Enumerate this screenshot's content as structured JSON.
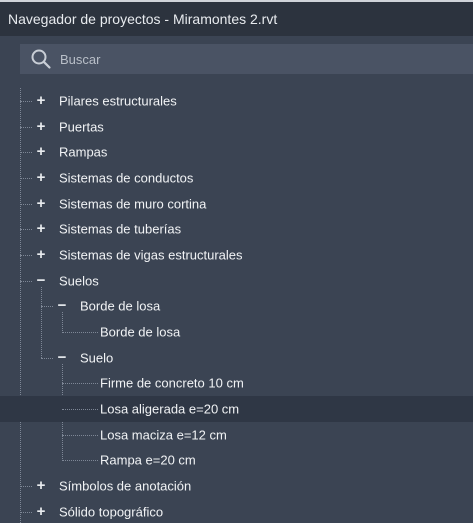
{
  "window": {
    "title": "Navegador de proyectos - Miramontes 2.rvt"
  },
  "search": {
    "placeholder": "Buscar",
    "value": ""
  },
  "tree": [
    {
      "label": "Pilares estructurales",
      "level": 0,
      "state": "collapsed"
    },
    {
      "label": "Puertas",
      "level": 0,
      "state": "collapsed"
    },
    {
      "label": "Rampas",
      "level": 0,
      "state": "collapsed"
    },
    {
      "label": "Sistemas de conductos",
      "level": 0,
      "state": "collapsed"
    },
    {
      "label": "Sistemas de muro cortina",
      "level": 0,
      "state": "collapsed"
    },
    {
      "label": "Sistemas de tuberías",
      "level": 0,
      "state": "collapsed"
    },
    {
      "label": "Sistemas de vigas estructurales",
      "level": 0,
      "state": "collapsed"
    },
    {
      "label": "Suelos",
      "level": 0,
      "state": "expanded"
    },
    {
      "label": "Borde de losa",
      "level": 1,
      "state": "expanded"
    },
    {
      "label": "Borde de losa",
      "level": 2,
      "state": "leaf"
    },
    {
      "label": "Suelo",
      "level": 1,
      "state": "expanded"
    },
    {
      "label": "Firme de concreto 10 cm",
      "level": 2,
      "state": "leaf"
    },
    {
      "label": "Losa aligerada e=20 cm",
      "level": 2,
      "state": "leaf",
      "selected": true
    },
    {
      "label": "Losa maciza e=12 cm",
      "level": 2,
      "state": "leaf"
    },
    {
      "label": "Rampa e=20 cm",
      "level": 2,
      "state": "leaf"
    },
    {
      "label": "Símbolos de anotación",
      "level": 0,
      "state": "collapsed"
    },
    {
      "label": "Sólido topográfico",
      "level": 0,
      "state": "collapsed"
    }
  ],
  "icons": {
    "search": "search-icon",
    "expand": "plus-icon",
    "collapse": "minus-icon"
  },
  "colors": {
    "background": "#3b4453",
    "titlebar": "#2c333e",
    "search_background": "#4a5364",
    "selected_row": "#2f3745",
    "text": "#f1f3f5"
  }
}
